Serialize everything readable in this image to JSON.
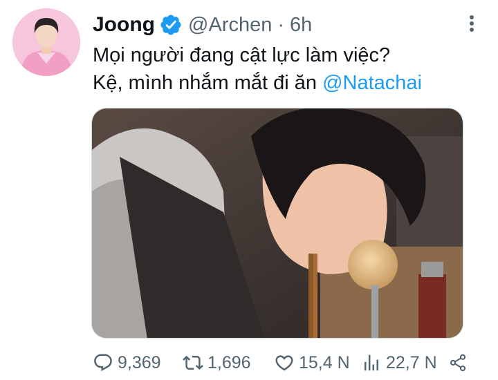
{
  "tweet": {
    "author_name": "Joong",
    "handle": "@Archen",
    "separator": "·",
    "time": "6h",
    "text_line1": "Mọi người đang cật lực làm việc?",
    "text_line2_prefix": "Kệ, mình nhắm mắt đi ăn ",
    "mention": "@Natachai"
  },
  "actions": {
    "replies": "9,369",
    "retweets": "1,696",
    "likes": "15,4 N",
    "views": "22,7 N"
  },
  "colors": {
    "text": "#0f1419",
    "muted": "#536471",
    "link": "#1d9bf0",
    "verified": "#1d9bf0"
  },
  "icons": [
    "verified-badge-icon",
    "more-icon",
    "reply-icon",
    "retweet-icon",
    "like-icon",
    "views-icon",
    "share-icon"
  ]
}
